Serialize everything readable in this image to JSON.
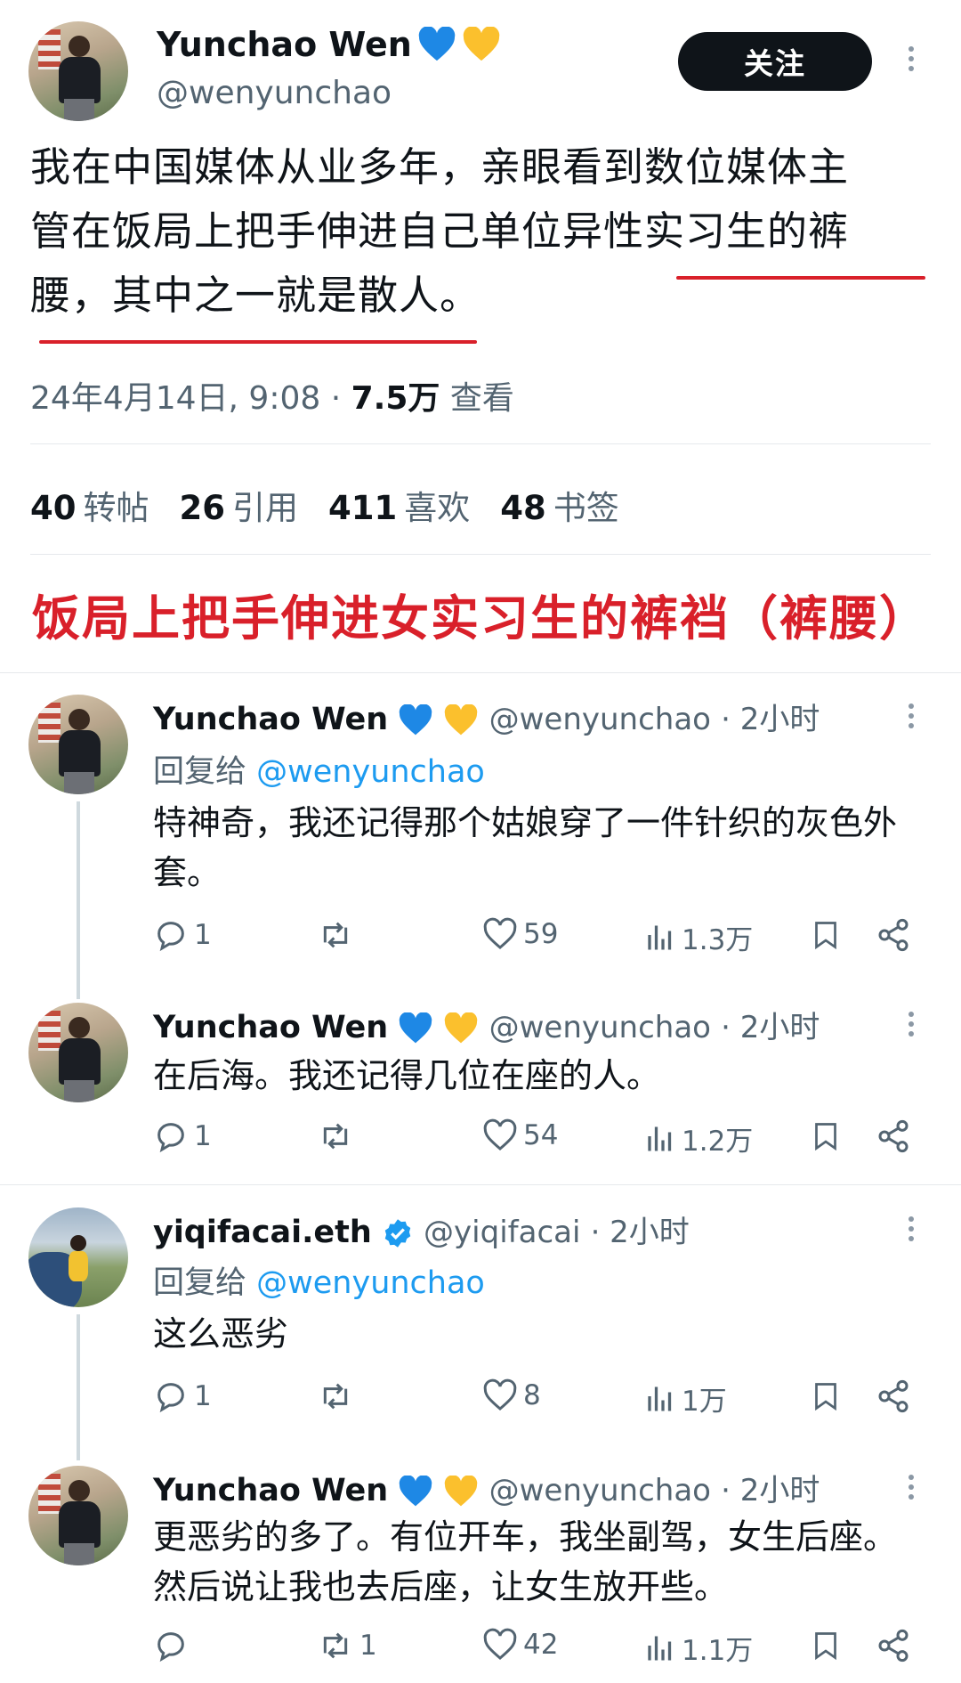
{
  "main_tweet": {
    "author_name": "Yunchao Wen",
    "handle": "@wenyunchao",
    "follow_label": "关注",
    "text_line1": "我在中国媒体从业多年，亲眼看到数位媒体主",
    "text_line2": "管在饭局上把手伸进自己单位异性实习生的裤",
    "text_line3": "腰，其中之一就是散人。",
    "timestamp": "24年4月14日, 9:08 · ",
    "views_value": "7.5万",
    "views_label": " 查看",
    "stats": {
      "retweets": "40",
      "retweets_label": "转帖",
      "quotes": "26",
      "quotes_label": "引用",
      "likes": "411",
      "likes_label": "喜欢",
      "bookmarks": "48",
      "bookmarks_label": "书签"
    }
  },
  "banner_text": "饭局上把手伸进女实习生的裤裆（裤腰）",
  "replies": [
    {
      "name": "Yunchao Wen",
      "handle": "@wenyunchao",
      "time": "· 2小时",
      "reply_to_prefix": "回复给 ",
      "reply_to_handle": "@wenyunchao",
      "text": "特神奇，我还记得那个姑娘穿了一件针织的灰色外套。",
      "comments": "1",
      "retweets": "",
      "likes": "59",
      "views": "1.3万"
    },
    {
      "name": "Yunchao Wen",
      "handle": "@wenyunchao",
      "time": "· 2小时",
      "text": "在后海。我还记得几位在座的人。",
      "comments": "1",
      "retweets": "",
      "likes": "54",
      "views": "1.2万"
    },
    {
      "name": "yiqifacai.eth",
      "handle": "@yiqifacai",
      "time": "· 2小时",
      "reply_to_prefix": "回复给 ",
      "reply_to_handle": "@wenyunchao",
      "text": "这么恶劣",
      "comments": "1",
      "retweets": "",
      "likes": "8",
      "views": "1万"
    },
    {
      "name": "Yunchao Wen",
      "handle": "@wenyunchao",
      "time": "· 2小时",
      "text": "更恶劣的多了。有位开车，我坐副驾，女生后座。然后说让我也去后座，让女生放开些。",
      "comments": "",
      "retweets": "1",
      "likes": "42",
      "views": "1.1万"
    }
  ],
  "colors": {
    "accent": "#1d9bf0",
    "highlight_red": "#d9202a",
    "muted": "#536471"
  },
  "icons": [
    "blue-heart-icon",
    "yellow-heart-icon",
    "verified-badge-icon",
    "reply-icon",
    "retweet-icon",
    "like-icon",
    "views-icon",
    "bookmark-icon",
    "share-icon",
    "more-icon"
  ]
}
